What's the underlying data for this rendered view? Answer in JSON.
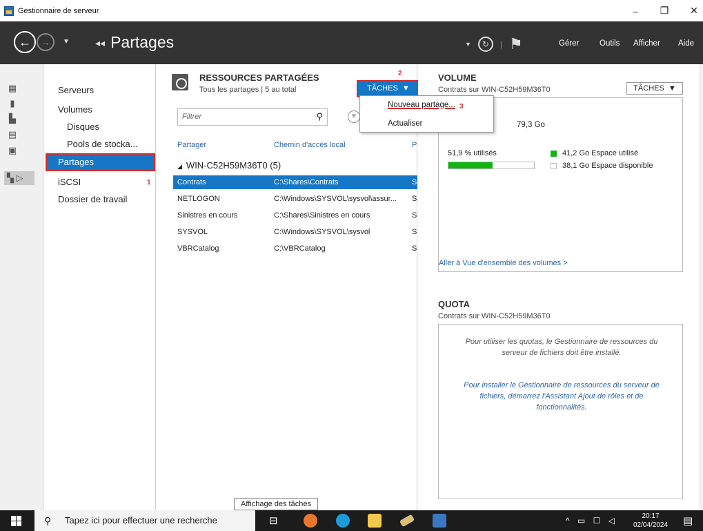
{
  "window": {
    "title": "Gestionnaire de serveur"
  },
  "header": {
    "title": "Partages",
    "menus": [
      "Gérer",
      "Outils",
      "Afficher",
      "Aide"
    ]
  },
  "nav": {
    "items": [
      {
        "label": "Serveurs"
      },
      {
        "label": "Volumes"
      },
      {
        "label": "Disques"
      },
      {
        "label": "Pools de stocka..."
      },
      {
        "label": "Partages"
      },
      {
        "label": "iSCSI"
      },
      {
        "label": "Dossier de travail"
      }
    ],
    "annot1": "1"
  },
  "shares": {
    "title": "RESSOURCES PARTAGÉES",
    "subtitle": "Tous les partages | 5 au total",
    "tasks_label": "TÂCHES",
    "annot2": "2",
    "filter_placeholder": "Filtrer",
    "columns": [
      "Partager",
      "Chemin d'accès local",
      "P"
    ],
    "group": "WIN-C52H59M36T0 (5)",
    "rows": [
      {
        "name": "Contrats",
        "path": "C:\\Shares\\Contrats",
        "p": "S"
      },
      {
        "name": "NETLOGON",
        "path": "C:\\Windows\\SYSVOL\\sysvol\\assur...",
        "p": "S"
      },
      {
        "name": "Sinistres en cours",
        "path": "C:\\Shares\\Sinistres en cours",
        "p": "S"
      },
      {
        "name": "SYSVOL",
        "path": "C:\\Windows\\SYSVOL\\sysvol",
        "p": "S"
      },
      {
        "name": "VBRCatalog",
        "path": "C:\\VBRCatalog",
        "p": "S"
      }
    ],
    "tooltip": "Affichage des tâches"
  },
  "dropdown": {
    "items": [
      "Nouveau partage...",
      "Actualiser"
    ],
    "annot3": "3"
  },
  "volume": {
    "title": "VOLUME",
    "subtitle": "Contrats sur WIN-C52H59M36T0",
    "tasks_label": "TÂCHES",
    "capacity": "79,3 Go",
    "used_pct_text": "51,9 % utilisés",
    "used_fraction": 0.519,
    "used_label": "41,2 Go Espace utilisé",
    "free_label": "38,1 Go Espace disponible",
    "link": "Aller à Vue d'ensemble des volumes >",
    "used_color": "#13b313"
  },
  "quota": {
    "title": "QUOTA",
    "subtitle": "Contrats sur WIN-C52H59M36T0",
    "msg1": "Pour utiliser les quotas, le Gestionnaire de ressources du serveur de fichiers doit être installé.",
    "msg2": "Pour installer le Gestionnaire de ressources du serveur de fichiers, démarrez l'Assistant Ajout de rôles et de fonctionnalités."
  },
  "taskbar": {
    "search": "Tapez ici pour effectuer une recherche",
    "time": "20:17",
    "date": "02/04/2024"
  }
}
